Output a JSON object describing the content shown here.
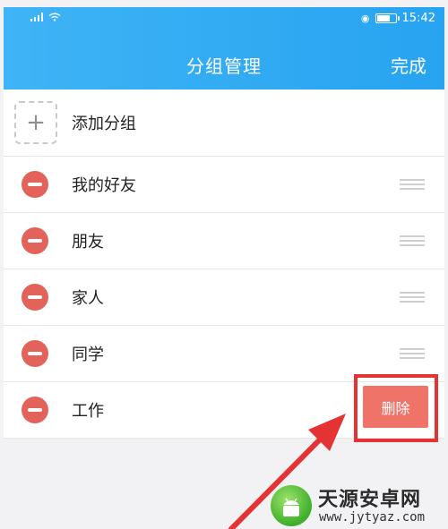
{
  "status_bar": {
    "time": "15:42"
  },
  "header": {
    "title": "分组管理",
    "done_label": "完成"
  },
  "list": {
    "add_label": "添加分组",
    "groups": [
      {
        "label": "我的好友"
      },
      {
        "label": "朋友"
      },
      {
        "label": "家人"
      },
      {
        "label": "同学"
      },
      {
        "label": "工作"
      }
    ]
  },
  "delete_label": "删除",
  "watermark": {
    "title": "天源安卓网",
    "url": "www.jytyaz.com"
  },
  "colors": {
    "header": "#27a3f0",
    "minus": "#e3625a",
    "delete": "#f0736a",
    "highlight": "#e33333"
  }
}
